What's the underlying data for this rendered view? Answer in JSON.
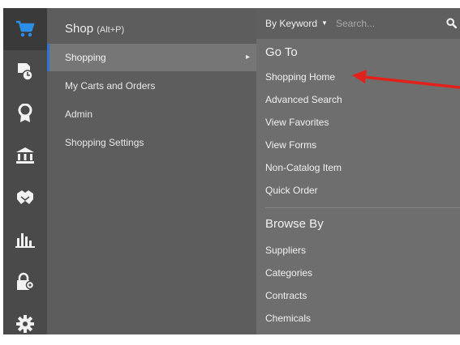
{
  "rail": {
    "icons": [
      "cart-icon",
      "document-clock-icon",
      "award-ribbon-icon",
      "bank-icon",
      "handshake-icon",
      "bar-chart-icon",
      "lock-gear-icon",
      "gear-icon"
    ]
  },
  "menu": {
    "title": "Shop",
    "title_hint": "(Alt+P)",
    "items": [
      {
        "label": "Shopping"
      },
      {
        "label": "My Carts and Orders"
      },
      {
        "label": "Admin"
      },
      {
        "label": "Shopping Settings"
      }
    ],
    "selected_index": 0,
    "chevron": "▸"
  },
  "flyout": {
    "search": {
      "mode_label": "By Keyword",
      "caret": "▼",
      "placeholder": "Search..."
    },
    "goto": {
      "heading": "Go To",
      "links": [
        {
          "label": "Shopping Home"
        },
        {
          "label": "Advanced Search"
        },
        {
          "label": "View Favorites"
        },
        {
          "label": "View Forms"
        },
        {
          "label": "Non-Catalog Item"
        },
        {
          "label": "Quick Order"
        }
      ]
    },
    "browse": {
      "heading": "Browse By",
      "links": [
        {
          "label": "Suppliers"
        },
        {
          "label": "Categories"
        },
        {
          "label": "Contracts"
        },
        {
          "label": "Chemicals"
        }
      ]
    }
  },
  "colors": {
    "active_icon": "#2d8ee8",
    "annotation_arrow": "#e3211c",
    "selected_accent": "#2b75d6"
  }
}
